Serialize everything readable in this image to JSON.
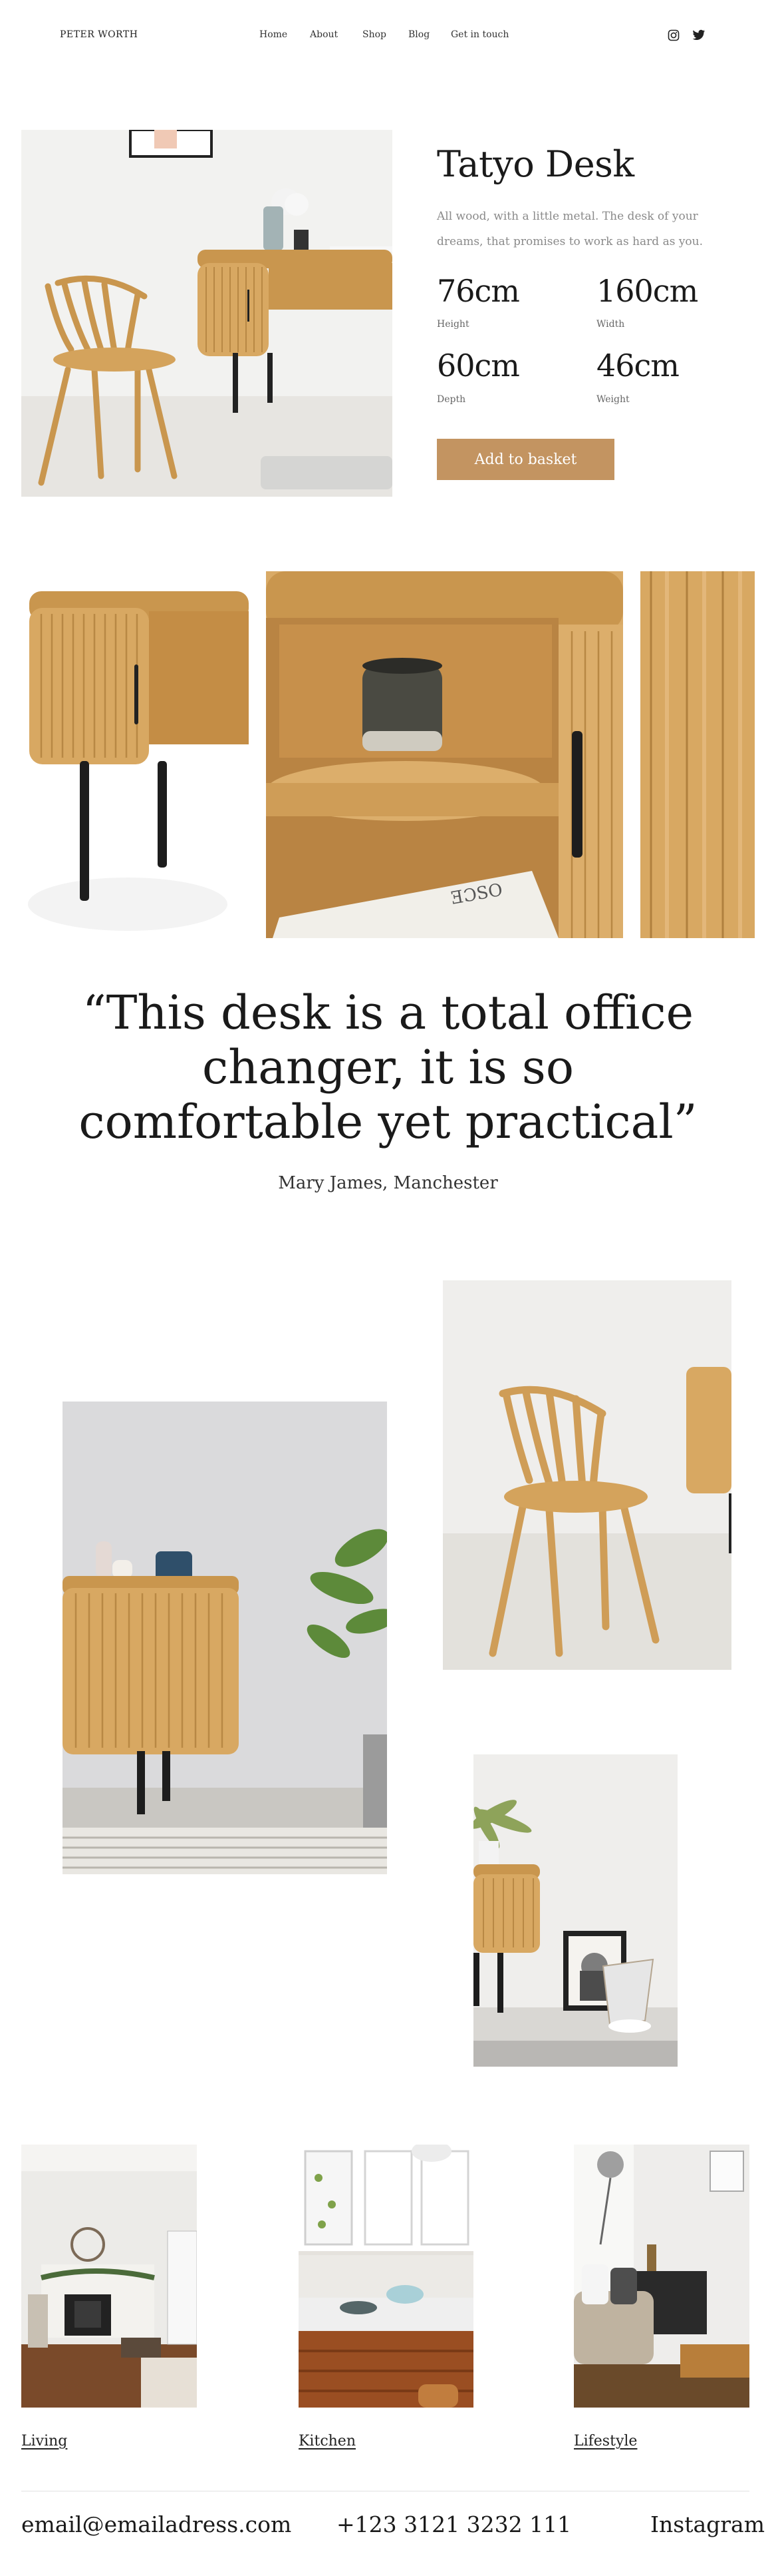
{
  "header": {
    "brand": "PETER WORTH",
    "nav": [
      "Home",
      "About",
      "Shop",
      "Blog",
      "Get in touch"
    ],
    "social": [
      "instagram-icon",
      "twitter-icon"
    ]
  },
  "product": {
    "title": "Tatyo Desk",
    "description": "All wood, with a little metal. The desk of your dreams, that promises to work as hard as you.",
    "specs": [
      {
        "value": "76cm",
        "label": "Height"
      },
      {
        "value": "160cm",
        "label": "Width"
      },
      {
        "value": "60cm",
        "label": "Depth"
      },
      {
        "value": "46cm",
        "label": "Weight"
      }
    ],
    "cta": "Add to basket"
  },
  "testimonial": {
    "quote": "“This desk is a total office changer, it is so comfortable yet practical”",
    "author": "Mary James, Manchester"
  },
  "categories": [
    "Living",
    "Kitchen",
    "Lifestyle"
  ],
  "footer": {
    "email": "email@emailadress.com",
    "phone": "+123 3121 3232 111",
    "social": "Instagram"
  },
  "colors": {
    "accent": "#c39461",
    "wood": "#d4a868",
    "text": "#1e1e1e",
    "muted": "#8a8a8a"
  }
}
